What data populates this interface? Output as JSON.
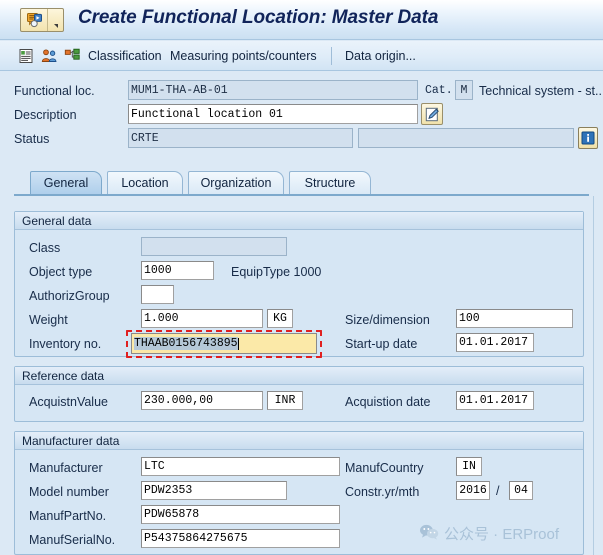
{
  "window": {
    "title": "Create Functional Location: Master Data",
    "sysmenu_icon": "sap-menu-icon",
    "dropdown_icon": "chevron-down-icon"
  },
  "toolbar": {
    "items": [
      {
        "type": "icon",
        "name": "list-icon",
        "label": ""
      },
      {
        "type": "icon",
        "name": "partners-icon",
        "label": ""
      },
      {
        "type": "icon",
        "name": "structure-icon",
        "label": ""
      },
      {
        "type": "button",
        "name": "classification-button",
        "label": "Classification"
      },
      {
        "type": "button",
        "name": "measuring-points-button",
        "label": "Measuring points/counters"
      },
      {
        "type": "button",
        "name": "data-origin-button",
        "label": "Data origin..."
      }
    ]
  },
  "header": {
    "functional_loc": {
      "label": "Functional loc.",
      "value": "MUM1-THA-AB-01"
    },
    "category": {
      "label": "Cat.",
      "value": "M",
      "description": "Technical system - st..."
    },
    "description": {
      "label": "Description",
      "value": "Functional location 01"
    },
    "description_edit_icon": "pencil-edit-icon",
    "status": {
      "label": "Status",
      "value": "CRTE",
      "extra_value": ""
    },
    "status_info_icon": "information-icon"
  },
  "tabs": [
    {
      "label": "General",
      "active": true
    },
    {
      "label": "Location",
      "active": false
    },
    {
      "label": "Organization",
      "active": false
    },
    {
      "label": "Structure",
      "active": false
    }
  ],
  "general_data": {
    "title": "General data",
    "class": {
      "label": "Class",
      "value": ""
    },
    "object_type": {
      "label": "Object type",
      "value": "1000",
      "description": "EquipType 1000"
    },
    "authoriz_group": {
      "label": "AuthorizGroup",
      "value": ""
    },
    "weight": {
      "label": "Weight",
      "value": "1.000",
      "unit": "KG"
    },
    "inventory_no": {
      "label": "Inventory no.",
      "value": "THAAB0156743895",
      "focused": true
    },
    "size_dimension": {
      "label": "Size/dimension",
      "value": "100"
    },
    "startup_date": {
      "label": "Start-up date",
      "value": "01.01.2017"
    }
  },
  "reference_data": {
    "title": "Reference data",
    "acquistn_value": {
      "label": "AcquistnValue",
      "value": "230.000,00",
      "currency": "INR"
    },
    "acquistion_date": {
      "label": "Acquistion date",
      "value": "01.01.2017"
    }
  },
  "manufacturer_data": {
    "title": "Manufacturer data",
    "manufacturer": {
      "label": "Manufacturer",
      "value": "LTC"
    },
    "manuf_country": {
      "label": "ManufCountry",
      "value": "IN"
    },
    "model_number": {
      "label": "Model number",
      "value": "PDW2353"
    },
    "constr_yr_mth": {
      "label": "Constr.yr/mth",
      "year": "2016",
      "separator": "/",
      "month": "04"
    },
    "manuf_part_no": {
      "label": "ManufPartNo.",
      "value": "PDW65878"
    },
    "manuf_serial_no": {
      "label": "ManufSerialNo.",
      "value": "P54375864275675"
    }
  },
  "watermark": {
    "icon": "wechat-icon",
    "text": "公众号 · ERProof"
  },
  "colors": {
    "page_background": "#dce9f5",
    "group_background": "#d6e6f4",
    "title_text": "#11245a",
    "focus_border": "#e02020",
    "focus_field_background": "#fbe9a8",
    "readonly_field_background": "#d2e0ee",
    "accent_border": "#9dbdd8"
  }
}
